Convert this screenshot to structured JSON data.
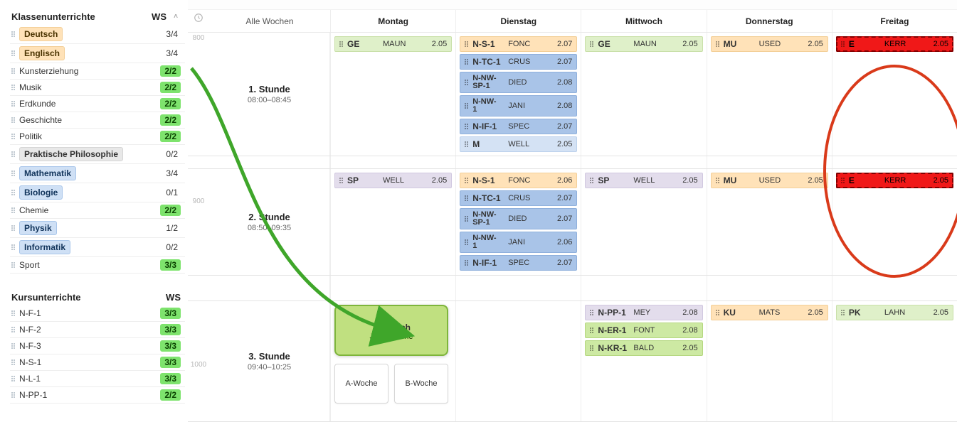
{
  "sidebar": {
    "section1": {
      "title": "Klassenunterrichte",
      "ws_label": "WS"
    },
    "section2": {
      "title": "Kursunterrichte",
      "ws_label": "WS"
    },
    "items1": [
      {
        "name": "Deutsch",
        "style": "orange",
        "ws": "3/4",
        "ws_style": "plain"
      },
      {
        "name": "Englisch",
        "style": "orange",
        "ws": "3/4",
        "ws_style": "plain"
      },
      {
        "name": "Kunsterziehung",
        "style": "none",
        "ws": "2/2",
        "ws_style": "green"
      },
      {
        "name": "Musik",
        "style": "none",
        "ws": "2/2",
        "ws_style": "green"
      },
      {
        "name": "Erdkunde",
        "style": "none",
        "ws": "2/2",
        "ws_style": "green"
      },
      {
        "name": "Geschichte",
        "style": "none",
        "ws": "2/2",
        "ws_style": "green"
      },
      {
        "name": "Politik",
        "style": "none",
        "ws": "2/2",
        "ws_style": "green"
      },
      {
        "name": "Praktische Philosophie",
        "style": "gray",
        "ws": "0/2",
        "ws_style": "plain"
      },
      {
        "name": "Mathematik",
        "style": "blue",
        "ws": "3/4",
        "ws_style": "plain"
      },
      {
        "name": "Biologie",
        "style": "blue",
        "ws": "0/1",
        "ws_style": "plain"
      },
      {
        "name": "Chemie",
        "style": "none",
        "ws": "2/2",
        "ws_style": "green"
      },
      {
        "name": "Physik",
        "style": "blue",
        "ws": "1/2",
        "ws_style": "plain"
      },
      {
        "name": "Informatik",
        "style": "blue",
        "ws": "0/2",
        "ws_style": "plain"
      },
      {
        "name": "Sport",
        "style": "none",
        "ws": "3/3",
        "ws_style": "green"
      }
    ],
    "items2": [
      {
        "name": "N-F-1",
        "ws": "3/3",
        "ws_style": "green"
      },
      {
        "name": "N-F-2",
        "ws": "3/3",
        "ws_style": "green"
      },
      {
        "name": "N-F-3",
        "ws": "3/3",
        "ws_style": "green"
      },
      {
        "name": "N-S-1",
        "ws": "3/3",
        "ws_style": "green"
      },
      {
        "name": "N-L-1",
        "ws": "3/3",
        "ws_style": "green"
      },
      {
        "name": "N-PP-1",
        "ws": "2/2",
        "ws_style": "green"
      }
    ]
  },
  "timeline": {
    "all_weeks": "Alle Wochen",
    "days": [
      "Montag",
      "Dienstag",
      "Mittwoch",
      "Donnerstag",
      "Freitag"
    ],
    "ticks": {
      "800": "800",
      "900": "900",
      "1000": "1000"
    },
    "slots": [
      {
        "title": "1. Stunde",
        "time": "08:00–08:45"
      },
      {
        "title": "2. Stunde",
        "time": "08:50–09:35"
      },
      {
        "title": "3. Stunde",
        "time": "09:40–10:25"
      }
    ],
    "grid": {
      "s1": {
        "mon": [
          {
            "code": "GE",
            "teach": "MAUN",
            "room": "2.05",
            "color": "green-l"
          }
        ],
        "tue": [
          {
            "code": "N-S-1",
            "teach": "FONC",
            "room": "2.07",
            "color": "orange"
          },
          {
            "code": "N-TC-1",
            "teach": "CRUS",
            "room": "2.07",
            "color": "blue-b"
          },
          {
            "code": "N-NW-\nSP-1",
            "teach": "DIED",
            "room": "2.08",
            "color": "blue-b",
            "two": true
          },
          {
            "code": "N-NW-\n1",
            "teach": "JANI",
            "room": "2.08",
            "color": "blue-b",
            "two": true
          },
          {
            "code": "N-IF-1",
            "teach": "SPEC",
            "room": "2.07",
            "color": "blue-b"
          },
          {
            "code": "M",
            "teach": "WELL",
            "room": "2.05",
            "color": "blue-l"
          }
        ],
        "wed": [
          {
            "code": "GE",
            "teach": "MAUN",
            "room": "2.05",
            "color": "green-l"
          }
        ],
        "thu": [
          {
            "code": "MU",
            "teach": "USED",
            "room": "2.05",
            "color": "orange"
          }
        ],
        "fri": [
          {
            "code": "E",
            "teach": "KERR",
            "room": "2.05",
            "color": "red",
            "dash": true
          }
        ]
      },
      "s2": {
        "mon": [
          {
            "code": "SP",
            "teach": "WELL",
            "room": "2.05",
            "color": "lilac"
          }
        ],
        "tue": [
          {
            "code": "N-S-1",
            "teach": "FONC",
            "room": "2.06",
            "color": "orange"
          },
          {
            "code": "N-TC-1",
            "teach": "CRUS",
            "room": "2.07",
            "color": "blue-b"
          },
          {
            "code": "N-NW-\nSP-1",
            "teach": "DIED",
            "room": "2.07",
            "color": "blue-b",
            "two": true
          },
          {
            "code": "N-NW-\n1",
            "teach": "JANI",
            "room": "2.06",
            "color": "blue-b",
            "two": true
          },
          {
            "code": "N-IF-1",
            "teach": "SPEC",
            "room": "2.07",
            "color": "blue-b"
          }
        ],
        "wed": [
          {
            "code": "SP",
            "teach": "WELL",
            "room": "2.05",
            "color": "lilac"
          }
        ],
        "thu": [
          {
            "code": "MU",
            "teach": "USED",
            "room": "2.05",
            "color": "orange"
          }
        ],
        "fri": [
          {
            "code": "E",
            "teach": "KERR",
            "room": "2.05",
            "color": "red",
            "dash": true
          }
        ]
      },
      "s3": {
        "mon": {
          "drop": {
            "name": "Englisch",
            "sub": "Jede Woche"
          },
          "weeks": [
            "A-Woche",
            "B-Woche"
          ]
        },
        "tue": [],
        "wed": [
          {
            "code": "N-PP-1",
            "teach": "MEY",
            "room": "2.08",
            "color": "lilac"
          },
          {
            "code": "N-ER-1",
            "teach": "FONT",
            "room": "2.08",
            "color": "green"
          },
          {
            "code": "N-KR-1",
            "teach": "BALD",
            "room": "2.05",
            "color": "green"
          }
        ],
        "thu": [
          {
            "code": "KU",
            "teach": "MATS",
            "room": "2.05",
            "color": "orange"
          }
        ],
        "fri": [
          {
            "code": "PK",
            "teach": "LAHN",
            "room": "2.05",
            "color": "green-l"
          }
        ]
      }
    }
  }
}
